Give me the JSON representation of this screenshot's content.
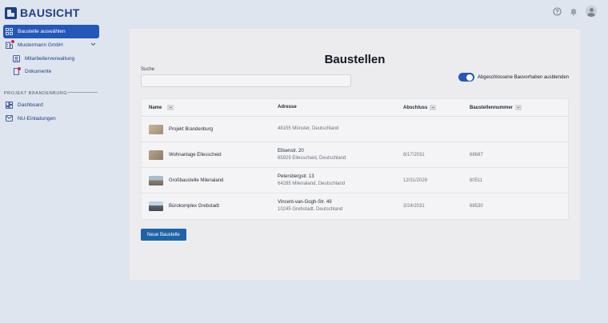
{
  "app": {
    "brand": "BAUSICHT"
  },
  "header": {
    "icons": [
      "help-icon",
      "bell-icon",
      "user-avatar-icon"
    ]
  },
  "sidebar": {
    "items": [
      {
        "label": "Baustelle auswählen",
        "icon": "grid-icon",
        "active": true
      },
      {
        "label": "Mustermann GmbH",
        "icon": "building-icon"
      },
      {
        "label": "Mitarbeiterverwaltung",
        "icon": "users-icon"
      },
      {
        "label": "Dokumente",
        "icon": "document-icon"
      }
    ],
    "section_label": "PROJEKT BRANDENBURG",
    "project_items": [
      {
        "label": "Dashboard",
        "icon": "dashboard-icon"
      },
      {
        "label": "NU-Einladungen",
        "icon": "mail-icon"
      }
    ]
  },
  "main": {
    "title": "Baustellen",
    "search": {
      "label": "Suche",
      "value": "",
      "placeholder": ""
    },
    "toggle": {
      "label": "Abgeschlossene Bauvorhaben ausblenden",
      "on": true
    },
    "table": {
      "columns": [
        "Name",
        "Adresse",
        "Abschluss",
        "Baustellennummer"
      ],
      "rows": [
        {
          "name": "Projekt Brandenburg",
          "address1": "48155 Münster, Deutschland",
          "address2": "",
          "date": "",
          "number": "",
          "thumb": "#b9a58c"
        },
        {
          "name": "Wohnanlage Ellesscheid",
          "address1": "Ellsenstr. 20",
          "address2": "65929 Ellesscheid, Deutschland",
          "date": "8/17/2031",
          "number": "68687",
          "thumb": "#a89680"
        },
        {
          "name": "Großbaustelle Milenaland",
          "address1": "Petersbergstr. 13",
          "address2": "64285 Milenaland, Deutschland",
          "date": "12/31/2028",
          "number": "60511",
          "thumb": "#8fa3b8"
        },
        {
          "name": "Bürokomplex Grebstadt",
          "address1": "Vincent-van-Gogh-Str. 49",
          "address2": "10245 Grebstadt, Deutschland",
          "date": "3/24/2031",
          "number": "68530",
          "thumb": "#7d8fa3"
        }
      ]
    },
    "new_button": "Neue Baustelle"
  },
  "colors": {
    "brand": "#1e3f8a",
    "accent": "#2357b8",
    "button": "#1e63a8",
    "background": "#dfe5ee",
    "panel": "#ececee"
  }
}
